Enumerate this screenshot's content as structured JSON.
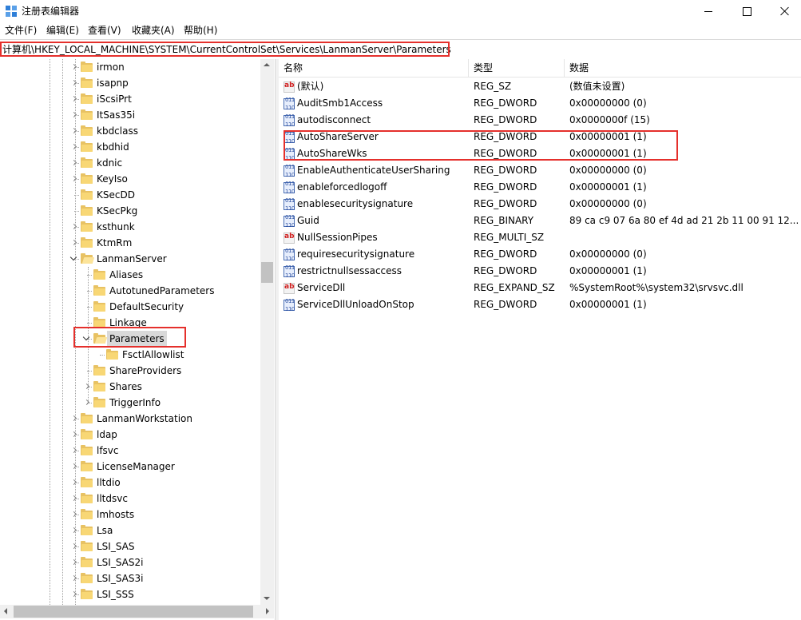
{
  "window": {
    "title": "注册表编辑器"
  },
  "menu": {
    "items": [
      "文件(F)",
      "编辑(E)",
      "查看(V)",
      "收藏夹(A)",
      "帮助(H)"
    ]
  },
  "address": {
    "path": "计算机\\HKEY_LOCAL_MACHINE\\SYSTEM\\CurrentControlSet\\Services\\LanmanServer\\Parameters"
  },
  "tree": {
    "items": [
      {
        "label": "irmon",
        "expander": "collapsed"
      },
      {
        "label": "isapnp",
        "expander": "collapsed"
      },
      {
        "label": "iScsiPrt",
        "expander": "collapsed"
      },
      {
        "label": "ItSas35i",
        "expander": "collapsed"
      },
      {
        "label": "kbdclass",
        "expander": "collapsed"
      },
      {
        "label": "kbdhid",
        "expander": "collapsed"
      },
      {
        "label": "kdnic",
        "expander": "collapsed"
      },
      {
        "label": "KeyIso",
        "expander": "collapsed"
      },
      {
        "label": "KSecDD",
        "expander": "none"
      },
      {
        "label": "KSecPkg",
        "expander": "none"
      },
      {
        "label": "ksthunk",
        "expander": "collapsed"
      },
      {
        "label": "KtmRm",
        "expander": "collapsed"
      },
      {
        "label": "LanmanServer",
        "expander": "expanded"
      },
      {
        "label": "Aliases",
        "expander": "none"
      },
      {
        "label": "AutotunedParameters",
        "expander": "none"
      },
      {
        "label": "DefaultSecurity",
        "expander": "none"
      },
      {
        "label": "Linkage",
        "expander": "none"
      },
      {
        "label": "Parameters",
        "expander": "expanded"
      },
      {
        "label": "FsctlAllowlist",
        "expander": "none"
      },
      {
        "label": "ShareProviders",
        "expander": "none"
      },
      {
        "label": "Shares",
        "expander": "collapsed"
      },
      {
        "label": "TriggerInfo",
        "expander": "collapsed"
      },
      {
        "label": "LanmanWorkstation",
        "expander": "collapsed"
      },
      {
        "label": "ldap",
        "expander": "collapsed"
      },
      {
        "label": "lfsvc",
        "expander": "collapsed"
      },
      {
        "label": "LicenseManager",
        "expander": "collapsed"
      },
      {
        "label": "lltdio",
        "expander": "collapsed"
      },
      {
        "label": "lltdsvc",
        "expander": "collapsed"
      },
      {
        "label": "lmhosts",
        "expander": "collapsed"
      },
      {
        "label": "Lsa",
        "expander": "collapsed"
      },
      {
        "label": "LSI_SAS",
        "expander": "collapsed"
      },
      {
        "label": "LSI_SAS2i",
        "expander": "collapsed"
      },
      {
        "label": "LSI_SAS3i",
        "expander": "collapsed"
      },
      {
        "label": "LSI_SSS",
        "expander": "collapsed"
      }
    ]
  },
  "list": {
    "columns": [
      "名称",
      "类型",
      "数据"
    ],
    "rows": [
      {
        "name": "(默认)",
        "type": "REG_SZ",
        "data": "(数值未设置)",
        "icon": "string-value-icon"
      },
      {
        "name": "AuditSmb1Access",
        "type": "REG_DWORD",
        "data": "0x00000000 (0)",
        "icon": "binary-value-icon"
      },
      {
        "name": "autodisconnect",
        "type": "REG_DWORD",
        "data": "0x0000000f (15)",
        "icon": "binary-value-icon"
      },
      {
        "name": "AutoShareServer",
        "type": "REG_DWORD",
        "data": "0x00000001 (1)",
        "icon": "binary-value-icon"
      },
      {
        "name": "AutoShareWks",
        "type": "REG_DWORD",
        "data": "0x00000001 (1)",
        "icon": "binary-value-icon"
      },
      {
        "name": "EnableAuthenticateUserSharing",
        "type": "REG_DWORD",
        "data": "0x00000000 (0)",
        "icon": "binary-value-icon"
      },
      {
        "name": "enableforcedlogoff",
        "type": "REG_DWORD",
        "data": "0x00000001 (1)",
        "icon": "binary-value-icon"
      },
      {
        "name": "enablesecuritysignature",
        "type": "REG_DWORD",
        "data": "0x00000000 (0)",
        "icon": "binary-value-icon"
      },
      {
        "name": "Guid",
        "type": "REG_BINARY",
        "data": "89 ca c9 07 6a 80 ef 4d ad 21 2b 11 00 91 12...",
        "icon": "binary-value-icon"
      },
      {
        "name": "NullSessionPipes",
        "type": "REG_MULTI_SZ",
        "data": "",
        "icon": "string-value-icon"
      },
      {
        "name": "requiresecuritysignature",
        "type": "REG_DWORD",
        "data": "0x00000000 (0)",
        "icon": "binary-value-icon"
      },
      {
        "name": "restrictnullsessaccess",
        "type": "REG_DWORD",
        "data": "0x00000001 (1)",
        "icon": "binary-value-icon"
      },
      {
        "name": "ServiceDll",
        "type": "REG_EXPAND_SZ",
        "data": "%SystemRoot%\\system32\\srvsvc.dll",
        "icon": "string-value-icon"
      },
      {
        "name": "ServiceDllUnloadOnStop",
        "type": "REG_DWORD",
        "data": "0x00000001 (1)",
        "icon": "binary-value-icon"
      }
    ]
  },
  "colors": {
    "highlight_border": "#e5302c",
    "folder": "#f8d775",
    "selection": "#d9d9d9"
  }
}
